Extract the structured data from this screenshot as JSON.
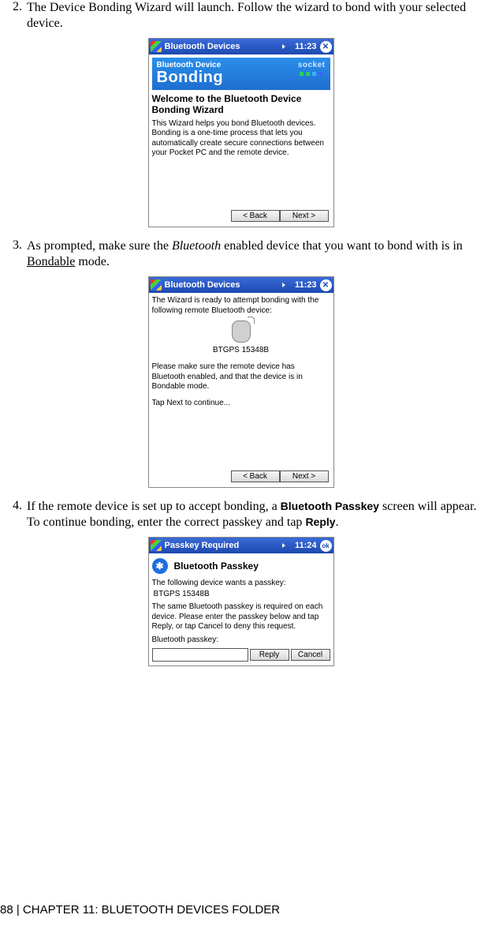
{
  "step2": {
    "num": "2.",
    "text_a": "The Device Bonding Wizard will launch. Follow the wizard to bond with your selected device."
  },
  "step3": {
    "num": "3.",
    "text_a": "As prompted, make sure the ",
    "text_italic": "Bluetooth",
    "text_b": " enabled device that you want to bond with is in ",
    "text_underline": "Bondable",
    "text_c": " mode."
  },
  "step4": {
    "num": "4.",
    "text_a": "If the remote device is set up to accept bonding, a ",
    "text_bold1": "Bluetooth Passkey",
    "text_b": " screen will appear. To continue bonding, enter the correct passkey and tap ",
    "text_bold2": "Reply",
    "text_c": "."
  },
  "shot1": {
    "title": "Bluetooth Devices",
    "time": "11:23",
    "close": "✕",
    "banner_small": "Bluetooth Device",
    "banner_big": "Bonding",
    "banner_socket": "socket",
    "welcome": "Welcome to the Bluetooth Device Bonding Wizard",
    "body": "This Wizard helps you bond Bluetooth devices. Bonding is a one-time process that lets you automatically create secure connections between your Pocket PC and the remote device.",
    "back": "< Back",
    "next": "Next >"
  },
  "shot2": {
    "title": "Bluetooth Devices",
    "time": "11:23",
    "close": "✕",
    "line1": "The Wizard is ready to attempt bonding with the following remote Bluetooth device:",
    "device": "BTGPS 15348B",
    "line2": "Please make sure the remote device has Bluetooth enabled, and that the device is in Bondable mode.",
    "line3": "Tap Next to continue...",
    "back": "< Back",
    "next": "Next >"
  },
  "shot3": {
    "title": "Passkey Required",
    "time": "11:24",
    "ok": "ok",
    "heading": "Bluetooth Passkey",
    "line1": "The following device wants a passkey:",
    "device": "BTGPS 15348B",
    "line2": "The same Bluetooth passkey is required on each device. Please enter the passkey below and tap Reply, or tap Cancel to deny this request.",
    "label": "Bluetooth passkey:",
    "reply": "Reply",
    "cancel": "Cancel"
  },
  "footer": "88 | CHAPTER 11: BLUETOOTH DEVICES FOLDER"
}
